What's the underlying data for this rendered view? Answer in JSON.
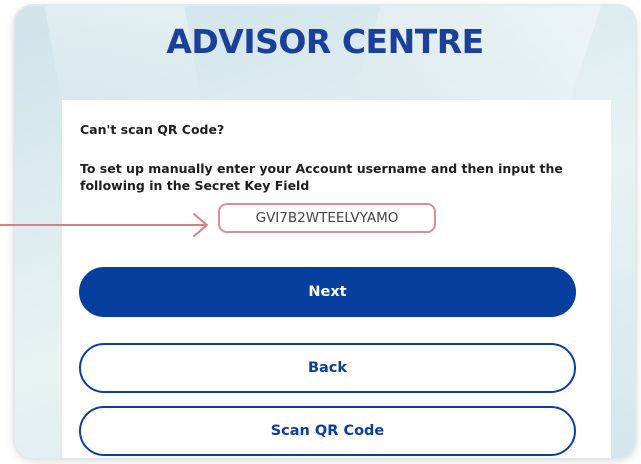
{
  "brand": {
    "title": "ADVISOR CENTRE"
  },
  "manual_setup": {
    "heading": "Can't scan QR Code?",
    "instructions": "To set up manually enter your Account username and then input the following in the Secret Key Field",
    "secret_key": "GVI7B2WTEELVYAMO"
  },
  "buttons": {
    "next_label": "Next",
    "back_label": "Back",
    "scan_label": "Scan QR Code"
  },
  "colors": {
    "brand_blue": "#1c3f9a",
    "primary_button": "#073f9e",
    "highlight": "#de8d93"
  },
  "icons": {
    "pointer": "arrow-right-icon"
  }
}
